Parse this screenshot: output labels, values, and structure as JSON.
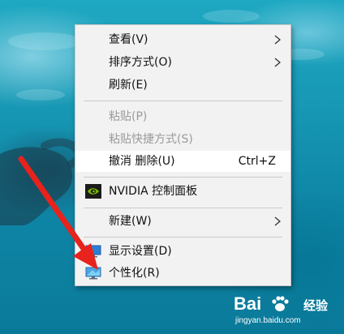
{
  "context_menu": {
    "items": [
      {
        "label": "查看(V)",
        "submenu": true
      },
      {
        "label": "排序方式(O)",
        "submenu": true
      },
      {
        "label": "刷新(E)"
      },
      {
        "label": "粘贴(P)",
        "disabled": true
      },
      {
        "label": "粘贴快捷方式(S)",
        "disabled": true
      },
      {
        "label": "撤消 删除(U)",
        "shortcut": "Ctrl+Z",
        "highlighted": true
      },
      {
        "label": "NVIDIA 控制面板",
        "icon": "nvidia-icon"
      },
      {
        "label": "新建(W)",
        "submenu": true
      },
      {
        "label": "显示设置(D)",
        "icon": "display-settings-icon"
      },
      {
        "label": "个性化(R)",
        "icon": "personalize-icon"
      }
    ]
  },
  "annotation": {
    "arrow_color": "#e8221c"
  },
  "watermark": {
    "brand": "Bai 经验",
    "brand_logo_text": "Bai",
    "brand_suffix": "经验",
    "url": "jingyan.baidu.com"
  },
  "colors": {
    "menu_bg": "#f2f2f2",
    "highlight_bg": "#ffffff",
    "disabled_text": "#9a9a9a",
    "water": "#1696b3"
  }
}
